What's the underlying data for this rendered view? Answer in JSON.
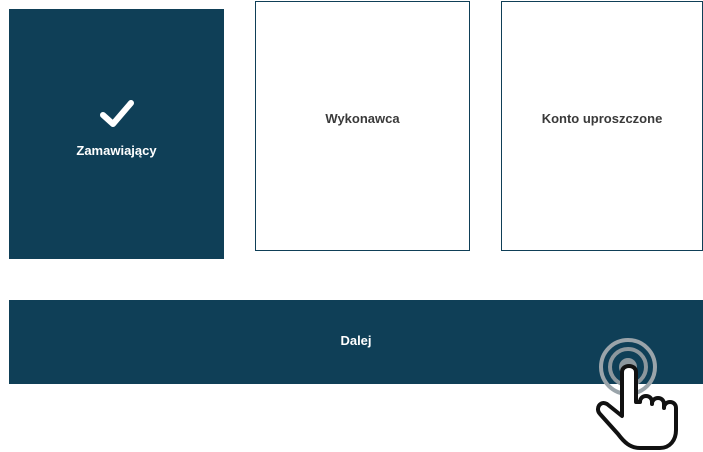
{
  "options": [
    {
      "label": "Zamawiający",
      "selected": true,
      "icon": "check-icon"
    },
    {
      "label": "Wykonawca",
      "selected": false
    },
    {
      "label": "Konto uproszczone",
      "selected": false
    }
  ],
  "next_button": {
    "label": "Dalej"
  },
  "cursor": {
    "icon": "hand-pointer-click-icon"
  },
  "colors": {
    "primary": "#0f3f57",
    "text_dark": "#3a3a3a",
    "text_light": "#ffffff"
  }
}
